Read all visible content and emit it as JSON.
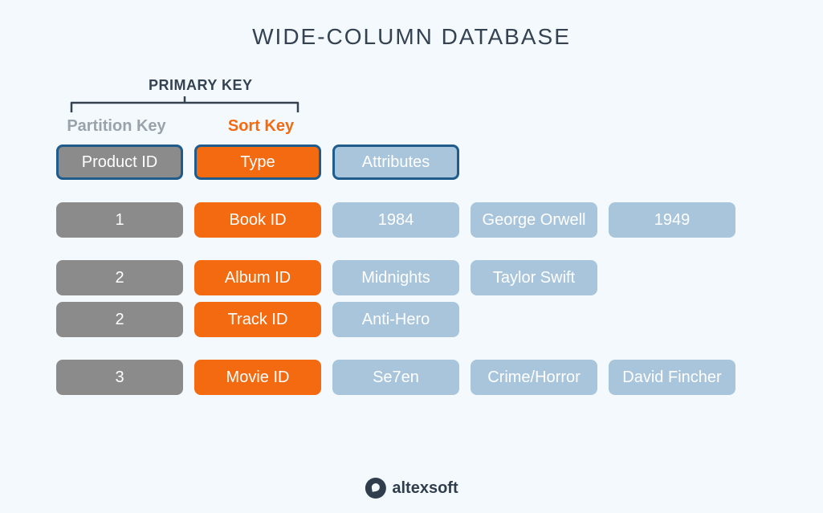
{
  "title": "WIDE-COLUMN DATABASE",
  "primary_key_label": "PRIMARY KEY",
  "partition_key_label": "Partition Key",
  "sort_key_label": "Sort Key",
  "headers": {
    "partition": "Product ID",
    "sort": "Type",
    "attr": "Attributes"
  },
  "rows": [
    {
      "id": "1",
      "type": "Book ID",
      "attrs": [
        "1984",
        "George Orwell",
        "1949"
      ]
    },
    {
      "id": "2",
      "type": "Album ID",
      "attrs": [
        "Midnights",
        "Taylor Swift"
      ]
    },
    {
      "id": "2",
      "type": "Track ID",
      "attrs": [
        "Anti-Hero"
      ]
    },
    {
      "id": "3",
      "type": "Movie ID",
      "attrs": [
        "Se7en",
        "Crime/Horror",
        "David Fincher"
      ]
    }
  ],
  "logo_text": "altexsoft"
}
